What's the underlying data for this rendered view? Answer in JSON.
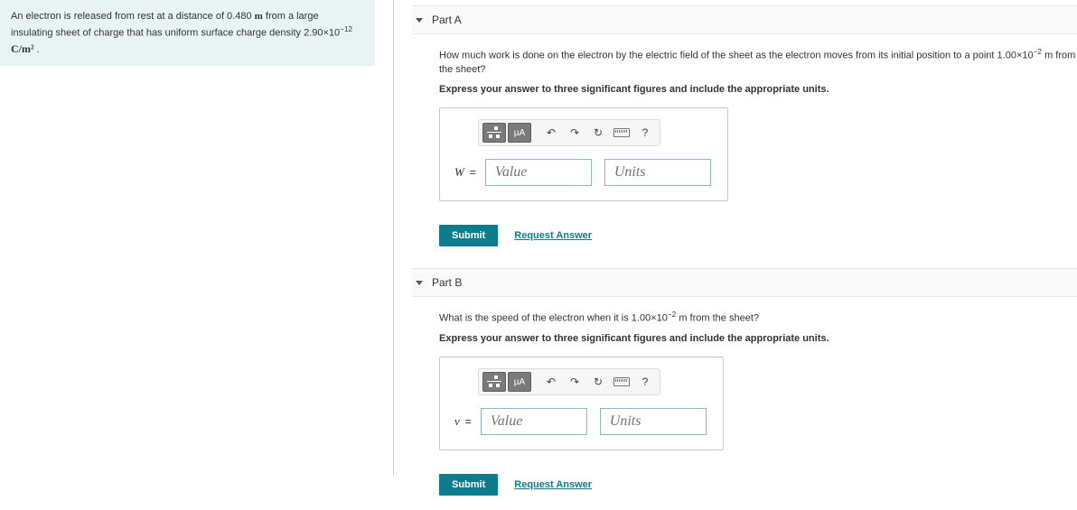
{
  "problem": {
    "line1_pre": "An electron is released from rest at a distance of 0.480 ",
    "line1_unit": "m",
    "line1_post": " from a large",
    "line2_pre": "insulating sheet of charge that has uniform surface charge density 2.90×10",
    "line2_exp": "−12",
    "line3_unit": "C/m²",
    "line3_post": " ."
  },
  "parts": [
    {
      "header": "Part A",
      "question_pre": "How much work is done on the electron by the electric field of the sheet as the electron moves from its initial position to a point 1.00×10",
      "question_exp": "−2",
      "question_mid": " ",
      "question_unit": "m",
      "question_post": " from the sheet?",
      "instruction": "Express your answer to three significant figures and include the appropriate units.",
      "variable": "W",
      "value_placeholder": "Value",
      "units_placeholder": "Units",
      "submit": "Submit",
      "request": "Request Answer",
      "toolbar": {
        "mu": "µA",
        "undo": "↶",
        "redo": "↷",
        "refresh": "↻",
        "help": "?"
      }
    },
    {
      "header": "Part B",
      "question_pre": "What is the speed of the electron when it is 1.00×10",
      "question_exp": "−2",
      "question_mid": " ",
      "question_unit": "m",
      "question_post": " from the sheet?",
      "instruction": "Express your answer to three significant figures and include the appropriate units.",
      "variable": "v",
      "value_placeholder": "Value",
      "units_placeholder": "Units",
      "submit": "Submit",
      "request": "Request Answer",
      "toolbar": {
        "mu": "µA",
        "undo": "↶",
        "redo": "↷",
        "refresh": "↻",
        "help": "?"
      }
    }
  ]
}
